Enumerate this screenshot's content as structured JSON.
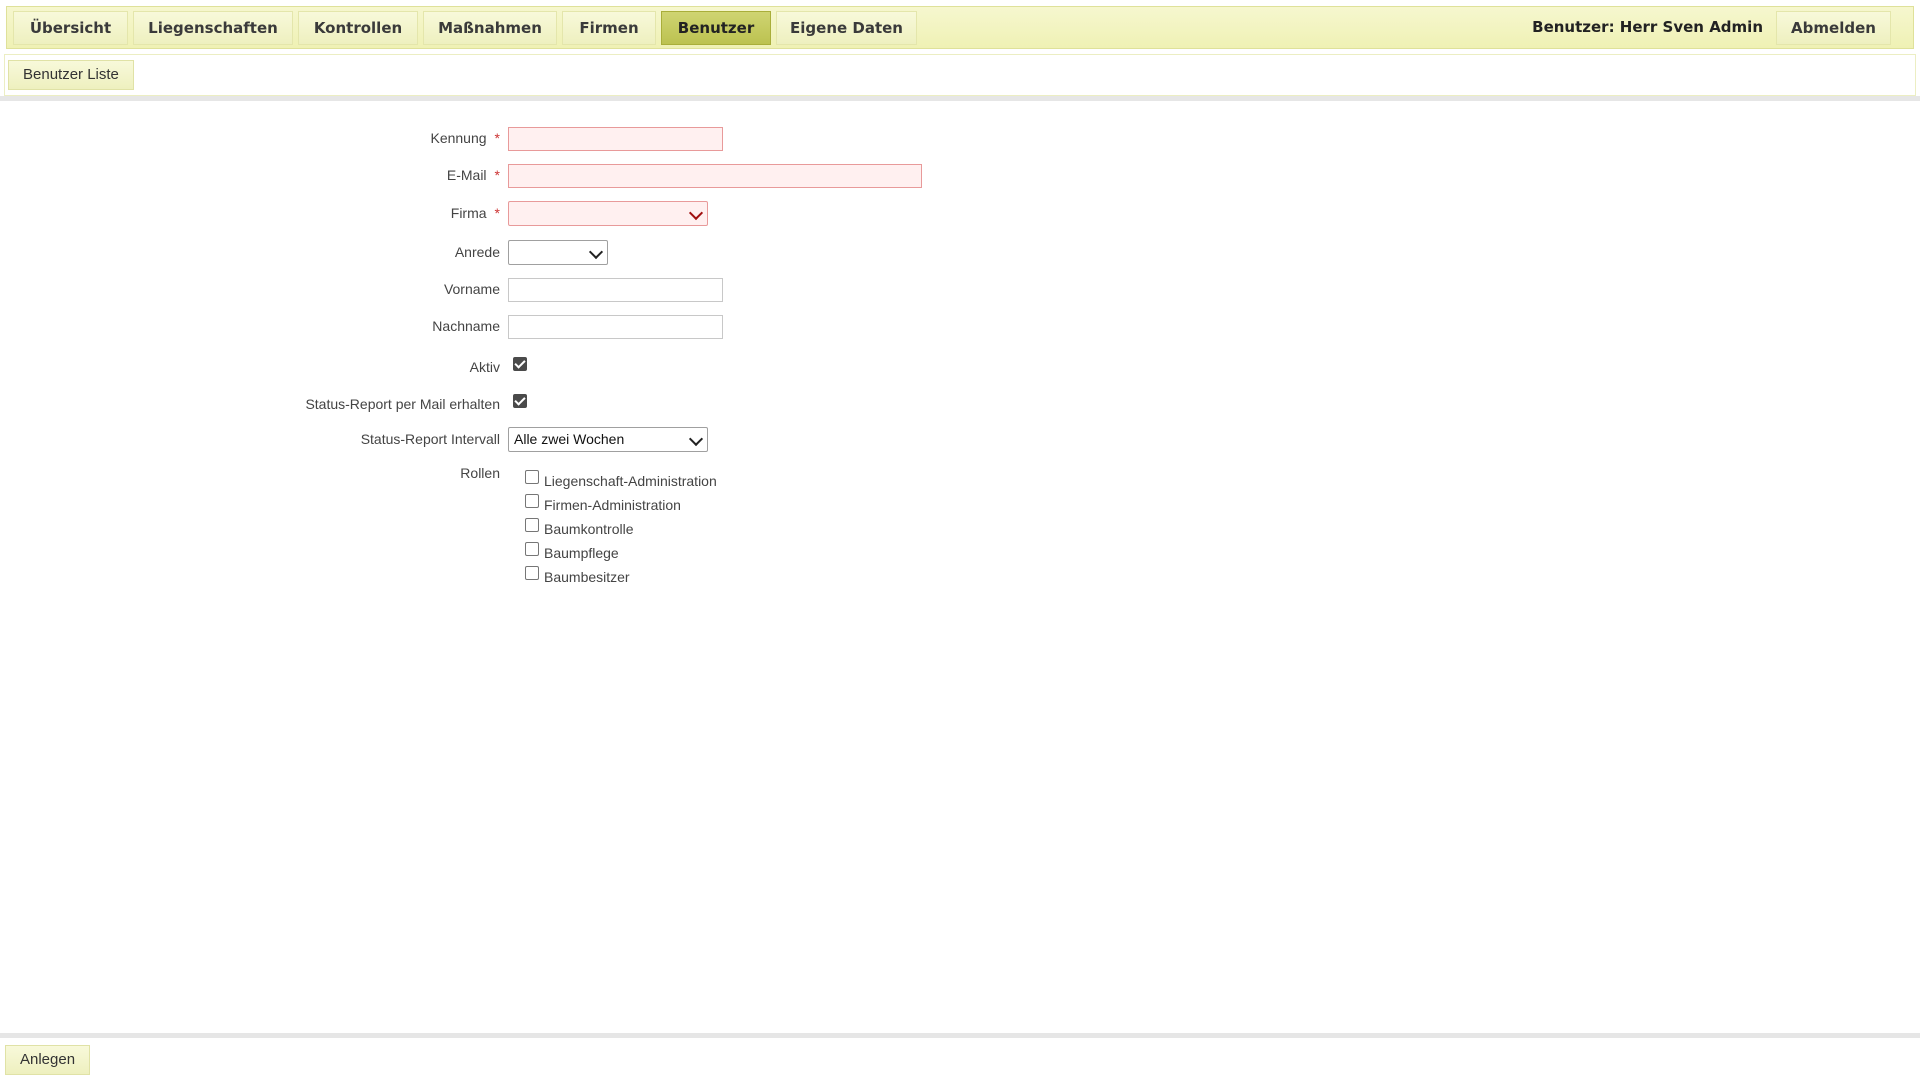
{
  "nav": {
    "tabs": [
      "Übersicht",
      "Liegenschaften",
      "Kontrollen",
      "Maßnahmen",
      "Firmen",
      "Benutzer",
      "Eigene Daten"
    ],
    "active_tab": "Benutzer",
    "user_label": "Benutzer: Herr Sven Admin",
    "logout": "Abmelden"
  },
  "subnav": {
    "list_button": "Benutzer Liste"
  },
  "form": {
    "required_marker": "*",
    "kennung": {
      "label": "Kennung",
      "value": ""
    },
    "email": {
      "label": "E-Mail",
      "value": ""
    },
    "firma": {
      "label": "Firma",
      "value": ""
    },
    "anrede": {
      "label": "Anrede",
      "value": ""
    },
    "vorname": {
      "label": "Vorname",
      "value": ""
    },
    "nachname": {
      "label": "Nachname",
      "value": ""
    },
    "aktiv": {
      "label": "Aktiv",
      "checked": true
    },
    "status_report": {
      "label": "Status-Report per Mail erhalten",
      "checked": true
    },
    "interval": {
      "label": "Status-Report Intervall",
      "value": "Alle zwei Wochen"
    },
    "rollen": {
      "label": "Rollen",
      "items": [
        {
          "label": "Liegenschaft-Administration",
          "checked": false
        },
        {
          "label": "Firmen-Administration",
          "checked": false
        },
        {
          "label": "Baumkontrolle",
          "checked": false
        },
        {
          "label": "Baumpflege",
          "checked": false
        },
        {
          "label": "Baumbesitzer",
          "checked": false
        }
      ]
    }
  },
  "footer": {
    "submit": "Anlegen"
  }
}
